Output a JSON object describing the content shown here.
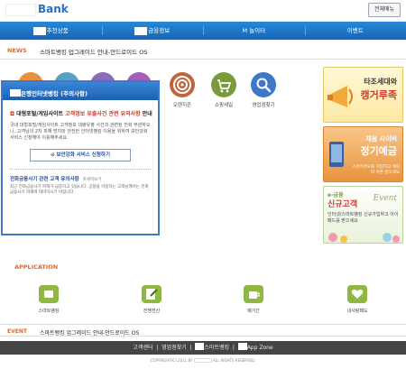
{
  "header": {
    "logo_text": "Bank",
    "menu_button": "전체메뉴"
  },
  "topnav": [
    {
      "label": "추천상품"
    },
    {
      "label": "금융정보"
    },
    {
      "label": "M 놀이터"
    },
    {
      "label": "이벤트"
    }
  ],
  "news": {
    "label": "NEWS",
    "text": "스마트뱅킹 업그레이드 안내-안드로이드 OS"
  },
  "quick_menu": [
    {
      "label": "오렌지존"
    },
    {
      "label": "쇼핑세일"
    },
    {
      "label": "영업점찾기"
    }
  ],
  "popup": {
    "header": "은행인터넷뱅킹 (주의사항)",
    "title_prefix": "대형포털/게임사이트",
    "title_red": "고객정보 유출사건 관련 유의사항",
    "title_suffix": "안내",
    "body": "국내 대형포털/게임사이트 고객정보 대량유출 사건과 관련된 전화 무관하오니, 고객님의 2차 피해 방지와 안전한 인터넷뱅킹 이용을 위하여 보안강화 서비스 신청해야 이용해주세요.",
    "button": "보안강화 서비스 신청하기",
    "section_title": "전화금융사기 관련 고객 유의사항",
    "section_more": "자세히보기",
    "section_body": "최근 전화금융사기 피해가 급증하고 있습니다. 공항을 이용하는 고객님께서는 전화금융사기 피해에 대비하시기 바랍니다."
  },
  "banners": [
    {
      "line1": "타조세대와",
      "line2": "캥거루족"
    },
    {
      "line1": "채움 사이버",
      "line2": "정기예금",
      "sub": "스마트폰으로 가입하고 캐릭터 쿠폰 받으세요"
    },
    {
      "line1": "e-금융",
      "line2": "신규고객",
      "word": "Event",
      "sub": "인터넷/스마트뱅킹 신규가입하고 아이패드를 받으세요"
    }
  ],
  "application": {
    "label": "APPLICATION",
    "apps": [
      {
        "label": "스마트뱅킹"
      },
      {
        "label": "전맹전산"
      },
      {
        "label": "폐기간"
      },
      {
        "label": "내사랑페도"
      }
    ]
  },
  "event": {
    "label": "EVENT",
    "text": "스마트뱅킹 업그레이드 안내-안드로이드 OS"
  },
  "footer": {
    "items": [
      "고객센터",
      "영업점찾기",
      "스마트뱅킹",
      "App Zone"
    ],
    "copyright_prefix": "COPYRIGHT(C) 2011 BY",
    "copyright_suffix": "ALL RIGHTS RESERVED."
  },
  "colors": {
    "primary": "#1e73c8",
    "accent": "#e06a2b",
    "footer": "#444444"
  }
}
